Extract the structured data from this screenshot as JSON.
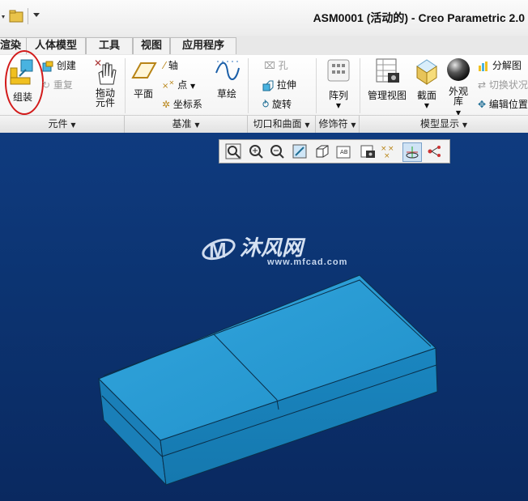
{
  "window": {
    "title": "ASM0001 (活动的) - Creo Parametric 2.0"
  },
  "tabs": [
    "渲染",
    "人体模型",
    "工具",
    "视图",
    "应用程序"
  ],
  "groups": {
    "component": {
      "label": "元件",
      "assemble": "组装",
      "create": "创建",
      "repeat": "重复",
      "drag": "拖动\n元件"
    },
    "datum": {
      "label": "基准",
      "plane": "平面",
      "axis": "轴",
      "point": "点",
      "csys": "坐标系",
      "sketch": "草绘"
    },
    "cut": {
      "label": "切口和曲面",
      "hole": "孔",
      "extrude": "拉伸",
      "revolve": "旋转"
    },
    "modifier": {
      "label": "修饰符",
      "pattern": "阵列"
    },
    "display": {
      "label": "模型显示",
      "manage_views": "管理视图",
      "section": "截面",
      "appearance": "外观\n库",
      "exploded": "分解图",
      "toggle": "切换状况",
      "edit_pos": "编辑位置"
    }
  },
  "view_toolbar": [
    "zoom-fit-icon",
    "zoom-in-icon",
    "zoom-out-icon",
    "repaint-icon",
    "display-style-icon",
    "saved-views-icon",
    "view-manager-icon",
    "datum-display-icon",
    "spin-center-icon",
    "annotation-display-icon"
  ],
  "watermark": {
    "brand": "沐风网",
    "url": "www.mfcad.com"
  },
  "colors": {
    "viewport_top": "#0f3b7f",
    "viewport_bottom": "#0a2960",
    "part": "#2a9bd6",
    "highlight": "#d21a1a"
  }
}
